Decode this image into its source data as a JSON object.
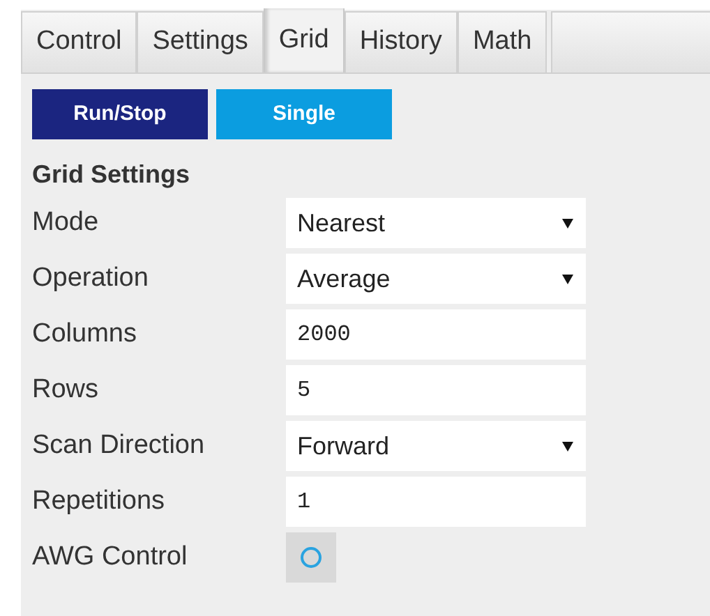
{
  "tabs": [
    {
      "label": "Control",
      "selected": false
    },
    {
      "label": "Settings",
      "selected": false
    },
    {
      "label": "Grid",
      "selected": true
    },
    {
      "label": "History",
      "selected": false
    },
    {
      "label": "Math",
      "selected": false
    }
  ],
  "buttons": [
    {
      "label": "Run/Stop",
      "kind": "primary"
    },
    {
      "label": "Single",
      "kind": "secondary"
    }
  ],
  "section_title": "Grid Settings",
  "fields": [
    {
      "label": "Mode",
      "kind": "select",
      "value": "Nearest"
    },
    {
      "label": "Operation",
      "kind": "select",
      "value": "Average"
    },
    {
      "label": "Columns",
      "kind": "number",
      "value": "2000"
    },
    {
      "label": "Rows",
      "kind": "number",
      "value": "5"
    },
    {
      "label": "Scan Direction",
      "kind": "select",
      "value": "Forward"
    },
    {
      "label": "Repetitions",
      "kind": "number",
      "value": "1"
    },
    {
      "label": "AWG Control",
      "kind": "toggle",
      "on": false
    }
  ]
}
